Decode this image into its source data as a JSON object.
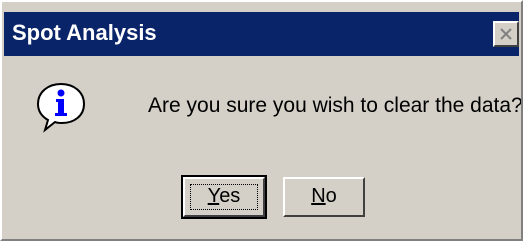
{
  "window": {
    "title": "Spot Analysis",
    "close_icon": "close-icon"
  },
  "message": {
    "icon": "info-icon",
    "text": "Are you sure you wish to clear the data?"
  },
  "buttons": {
    "yes": {
      "mnemonic": "Y",
      "rest": "es"
    },
    "no": {
      "mnemonic": "N",
      "rest": "o"
    }
  },
  "colors": {
    "title_bar": "#0a246a",
    "dialog_face": "#d4d0c8",
    "icon_accent": "#0000ff"
  }
}
